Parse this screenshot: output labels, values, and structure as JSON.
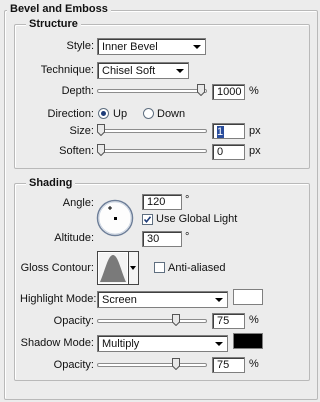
{
  "panel_title": "Bevel and Emboss",
  "structure": {
    "title": "Structure",
    "style": {
      "label": "Style:",
      "value": "Inner Bevel"
    },
    "technique": {
      "label": "Technique:",
      "value": "Chisel Soft"
    },
    "depth": {
      "label": "Depth:",
      "value": "1000",
      "unit": "%",
      "slider_fraction": 1.0
    },
    "direction": {
      "label": "Direction:",
      "options": [
        "Up",
        "Down"
      ],
      "selected": "Up"
    },
    "size": {
      "label": "Size:",
      "value": "1",
      "unit": "px",
      "slider_fraction": 0.0
    },
    "soften": {
      "label": "Soften:",
      "value": "0",
      "unit": "px",
      "slider_fraction": 0.0
    }
  },
  "shading": {
    "title": "Shading",
    "angle": {
      "label": "Angle:",
      "value": "120",
      "unit": "°"
    },
    "use_global_light": {
      "label": "Use Global Light",
      "checked": true
    },
    "altitude": {
      "label": "Altitude:",
      "value": "30",
      "unit": "°"
    },
    "gloss_contour": {
      "label": "Gloss Contour:"
    },
    "anti_aliased": {
      "label": "Anti-aliased",
      "checked": false
    },
    "highlight_mode": {
      "label": "Highlight Mode:",
      "value": "Screen",
      "color": "#ffffff"
    },
    "highlight_opacity": {
      "label": "Opacity:",
      "value": "75",
      "unit": "%",
      "slider_fraction": 0.75
    },
    "shadow_mode": {
      "label": "Shadow Mode:",
      "value": "Multiply",
      "color": "#000000"
    },
    "shadow_opacity": {
      "label": "Opacity:",
      "value": "75",
      "unit": "%",
      "slider_fraction": 0.75
    }
  }
}
